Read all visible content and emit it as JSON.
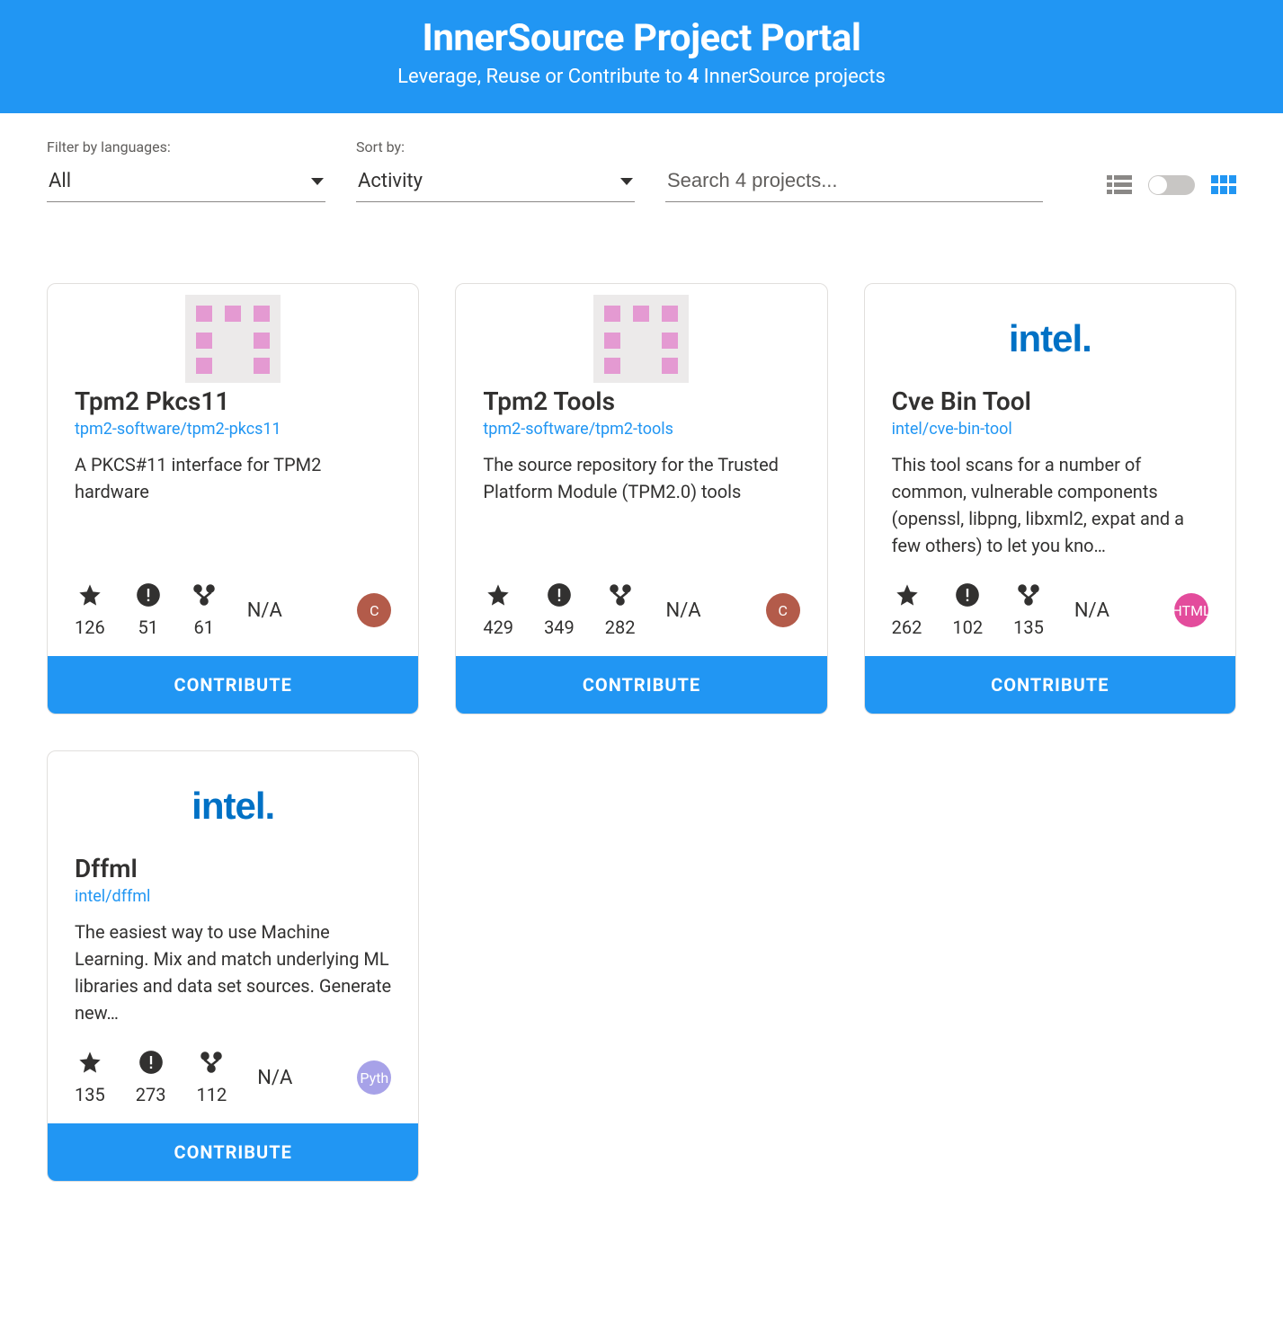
{
  "header": {
    "title": "InnerSource Project Portal",
    "subtitle_pre": "Leverage, Reuse or Contribute to ",
    "subtitle_count": "4",
    "subtitle_post": " InnerSource projects"
  },
  "filters": {
    "language_label": "Filter by languages:",
    "language_value": "All",
    "sort_label": "Sort by:",
    "sort_value": "Activity",
    "search_placeholder": "Search 4 projects..."
  },
  "contribute_label": "CONTRIBUTE",
  "score_label": "N/A",
  "projects": [
    {
      "title": "Tpm2 Pkcs11",
      "repo": "tpm2-software/tpm2-pkcs11",
      "desc": "A PKCS#11 interface for TPM2 hardware",
      "stars": "126",
      "issues": "51",
      "forks": "61",
      "lang": "C",
      "lang_color": "#b35b4a",
      "logo": "placeholder"
    },
    {
      "title": "Tpm2 Tools",
      "repo": "tpm2-software/tpm2-tools",
      "desc": "The source repository for the Trusted Platform Module (TPM2.0) tools",
      "stars": "429",
      "issues": "349",
      "forks": "282",
      "lang": "C",
      "lang_color": "#b35b4a",
      "logo": "placeholder"
    },
    {
      "title": "Cve Bin Tool",
      "repo": "intel/cve-bin-tool",
      "desc": "This tool scans for a number of common, vulnerable components (openssl, libpng, libxml2, expat and a few others) to let you kno…",
      "stars": "262",
      "issues": "102",
      "forks": "135",
      "lang": "HTML",
      "lang_color": "#e34c9c",
      "logo": "intel"
    },
    {
      "title": "Dffml",
      "repo": "intel/dffml",
      "desc": "The easiest way to use Machine Learning. Mix and match underlying ML libraries and data set sources. Generate new…",
      "stars": "135",
      "issues": "273",
      "forks": "112",
      "lang": "Pyth",
      "lang_color": "#a7a2e8",
      "logo": "intel"
    }
  ]
}
